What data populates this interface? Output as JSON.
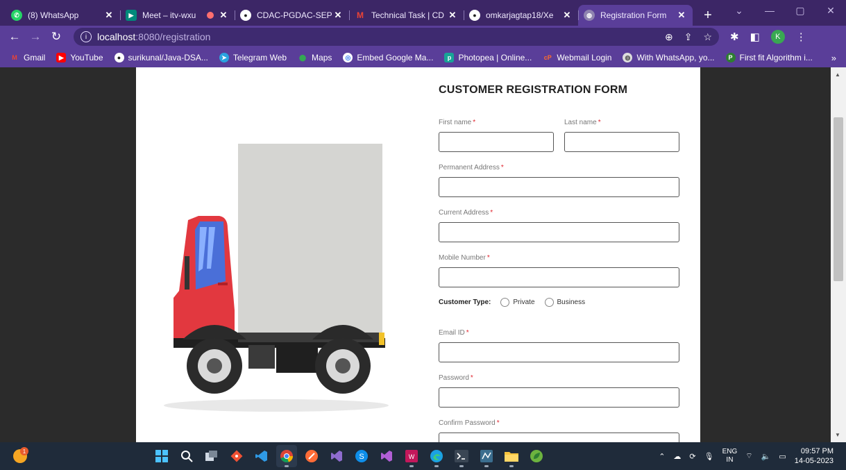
{
  "browser": {
    "tabs": [
      {
        "title": "(8) WhatsApp",
        "icon": "whatsapp-icon",
        "color": "#25d366",
        "active": false
      },
      {
        "title": "Meet – itv-wxu",
        "icon": "google-meet-icon",
        "color": "#00897b",
        "active": false
      },
      {
        "title": "CDAC-PGDAC-SEPT",
        "icon": "github-icon",
        "color": "#222222",
        "active": false
      },
      {
        "title": "Technical Task | CD",
        "icon": "gmail-icon",
        "color": "#ea4335",
        "active": false
      },
      {
        "title": "omkarjagtap18/Xe",
        "icon": "github-icon",
        "color": "#222222",
        "active": false
      },
      {
        "title": "Registration Form",
        "icon": "globe-icon",
        "color": "#9e9e9e",
        "active": true
      }
    ],
    "new_tab": "+",
    "window_controls": {
      "minimize": "—",
      "restore": "▢",
      "close": "✕",
      "dropdown": "⌄"
    },
    "address": {
      "host": "localhost",
      "path": ":8080/registration"
    },
    "profile_initial": "K",
    "bookmarks": [
      {
        "label": "Gmail",
        "icon": "gmail-icon",
        "color": "#ea4335"
      },
      {
        "label": "YouTube",
        "icon": "youtube-icon",
        "color": "#ff0000"
      },
      {
        "label": "surikunal/Java-DSA...",
        "icon": "github-icon",
        "color": "#ffffff"
      },
      {
        "label": "Telegram Web",
        "icon": "telegram-icon",
        "color": "#2aa3df"
      },
      {
        "label": "Maps",
        "icon": "maps-icon",
        "color": "#34a853"
      },
      {
        "label": "Embed Google Ma...",
        "icon": "embed-icon",
        "color": "#4285f4"
      },
      {
        "label": "Photopea | Online...",
        "icon": "photopea-icon",
        "color": "#18a497"
      },
      {
        "label": "Webmail Login",
        "icon": "cpanel-icon",
        "color": "#ff6c2c"
      },
      {
        "label": "With WhatsApp, yo...",
        "icon": "globe-icon",
        "color": "#bbbbbb"
      },
      {
        "label": "First fit Algorithm i...",
        "icon": "bookmark-site-icon",
        "color": "#2e7d32"
      }
    ],
    "bookmarks_overflow": "»"
  },
  "form": {
    "title": "CUSTOMER REGISTRATION FORM",
    "required_mark": "*",
    "fields": {
      "first_name": "First name",
      "last_name": "Last name",
      "permanent_address": "Permanent Address",
      "current_address": "Current Address",
      "mobile": "Mobile Number",
      "email": "Email ID",
      "password": "Password",
      "confirm_password": "Confirm Password"
    },
    "customer_type": {
      "label": "Customer Type:",
      "options": [
        "Private",
        "Business"
      ]
    }
  },
  "taskbar": {
    "apps": [
      "windows-start-icon",
      "search-icon",
      "task-view-icon",
      "git-icon",
      "vscode-icon",
      "chrome-icon",
      "postman-icon",
      "visual-studio-icon",
      "skype-icon",
      "visual-studio-purple-icon",
      "wamp-icon",
      "edge-icon",
      "terminal-icon",
      "mysql-workbench-icon",
      "file-explorer-icon",
      "spring-tools-icon"
    ],
    "weather_badge": "1",
    "lang_top": "ENG",
    "lang_bottom": "IN",
    "time": "09:57 PM",
    "date": "14-05-2023"
  }
}
